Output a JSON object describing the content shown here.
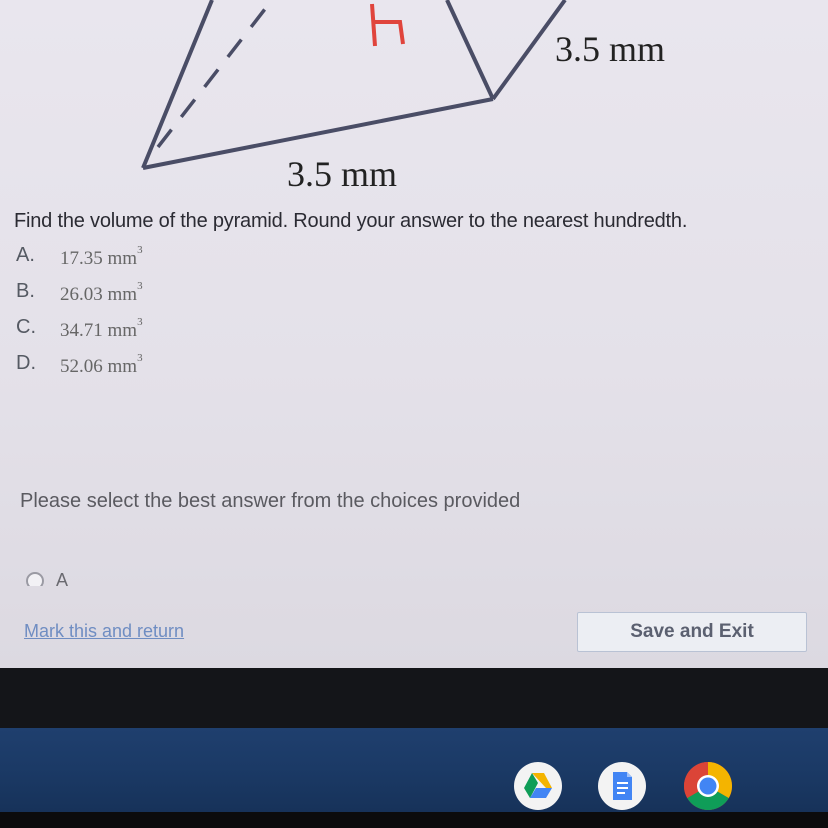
{
  "diagram": {
    "height_label": "h",
    "edge_label_right": "3.5 mm",
    "edge_label_bottom": "3.5 mm"
  },
  "question": {
    "text": "Find the volume of the pyramid. Round your answer to the nearest hundredth."
  },
  "choices": [
    {
      "letter": "A.",
      "value": "17.35 mm",
      "exp": "3"
    },
    {
      "letter": "B.",
      "value": "26.03 mm",
      "exp": "3"
    },
    {
      "letter": "C.",
      "value": "34.71 mm",
      "exp": "3"
    },
    {
      "letter": "D.",
      "value": "52.06 mm",
      "exp": "3"
    }
  ],
  "prompt": "Please select the best answer from the choices provided",
  "radio": {
    "label": "A"
  },
  "footer": {
    "mark_link": "Mark this and return",
    "save_button": "Save and Exit"
  },
  "shelf": {
    "apps": [
      "google-drive-icon",
      "google-docs-icon",
      "chrome-icon"
    ]
  },
  "colors": {
    "height_line": "#e0443c",
    "edge": "#4a4d66",
    "link": "#6f8dc2"
  }
}
